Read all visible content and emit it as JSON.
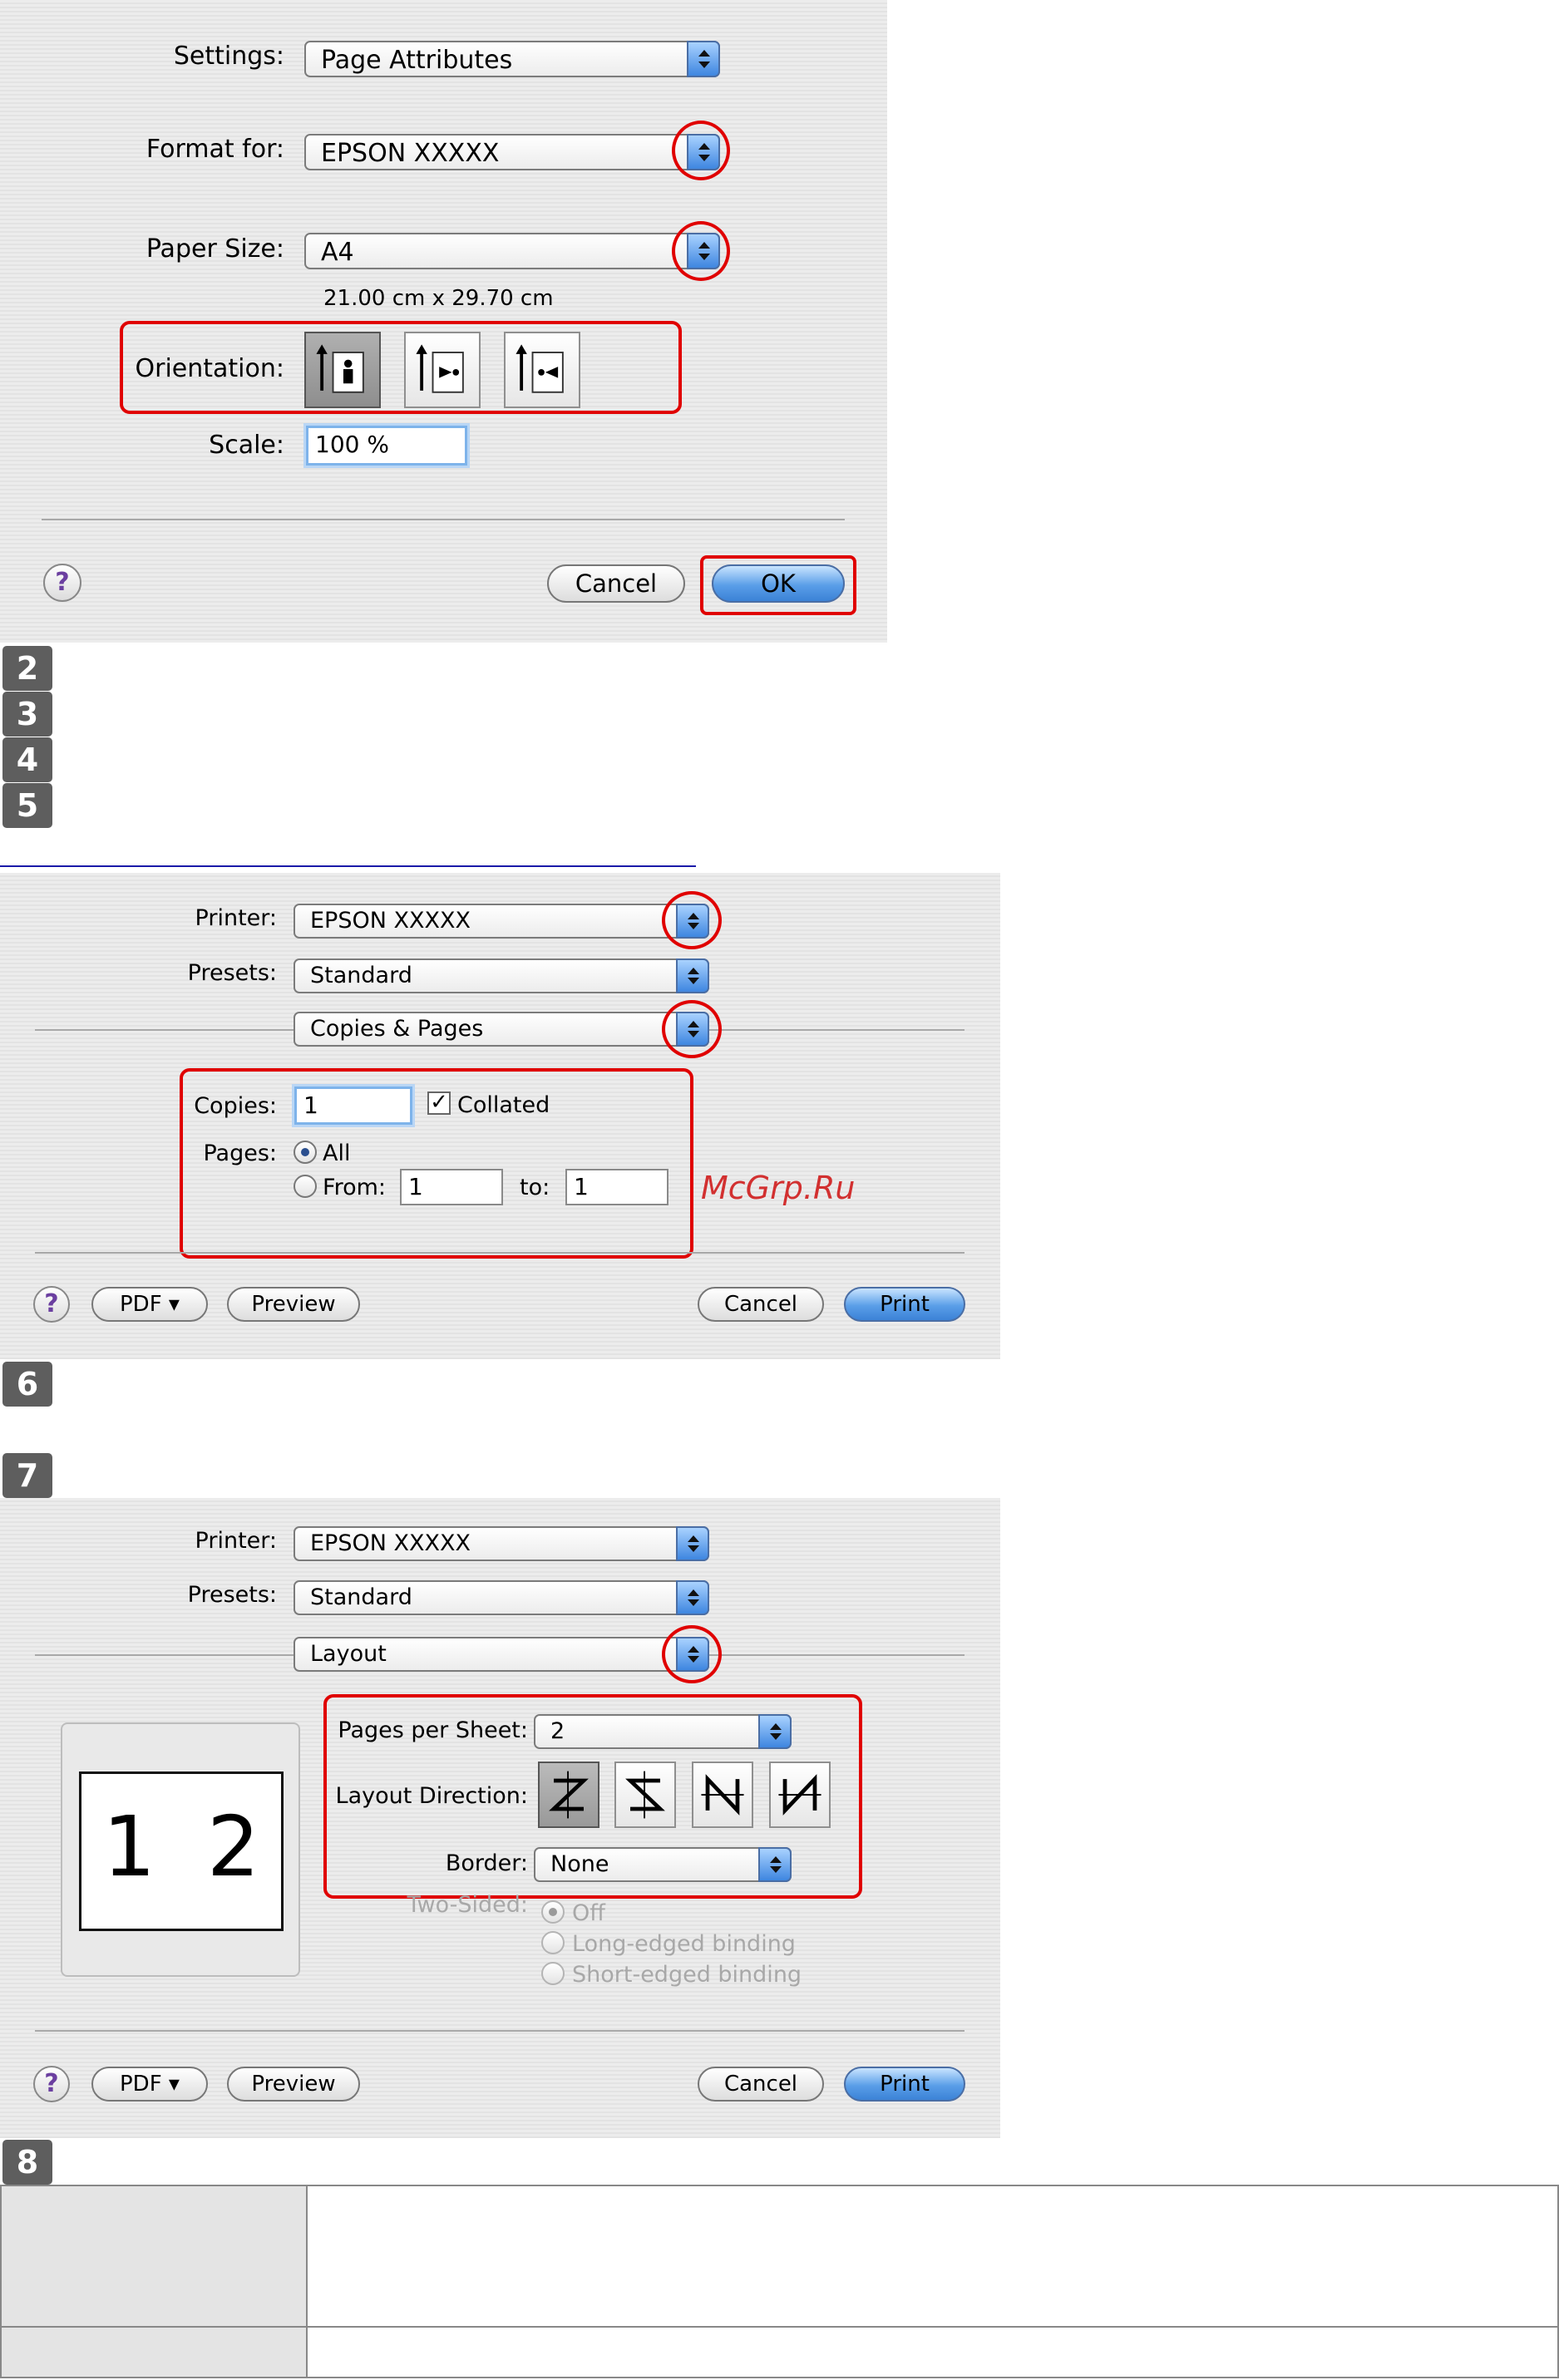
{
  "page_setup": {
    "settings_label": "Settings:",
    "settings_value": "Page Attributes",
    "format_for_label": "Format for:",
    "format_for_value": "EPSON XXXXX",
    "paper_size_label": "Paper Size:",
    "paper_size_value": "A4",
    "paper_dimensions": "21.00 cm x 29.70 cm",
    "orientation_label": "Orientation:",
    "orientation_selected": "portrait",
    "scale_label": "Scale:",
    "scale_value": "100 %",
    "help_glyph": "?",
    "cancel_label": "Cancel",
    "ok_label": "OK"
  },
  "steps": {
    "s2": "2",
    "s3": "3",
    "s4": "4",
    "s5": "5",
    "s6": "6",
    "s7": "7",
    "s8": "8"
  },
  "print_copies": {
    "printer_label": "Printer:",
    "printer_value": "EPSON XXXXX",
    "presets_label": "Presets:",
    "presets_value": "Standard",
    "panel_value": "Copies & Pages",
    "copies_label": "Copies:",
    "copies_value": "1",
    "collated_label": "Collated",
    "collated_checked": true,
    "pages_label": "Pages:",
    "all_label": "All",
    "from_label": "From:",
    "from_value": "1",
    "to_label": "to:",
    "to_value": "1",
    "help_glyph": "?",
    "pdf_label": "PDF ▾",
    "preview_label": "Preview",
    "cancel_label": "Cancel",
    "print_label": "Print"
  },
  "watermark": "McGrp.Ru",
  "print_layout": {
    "printer_label": "Printer:",
    "printer_value": "EPSON XXXXX",
    "presets_label": "Presets:",
    "presets_value": "Standard",
    "panel_value": "Layout",
    "preview_digits": "1 2",
    "pages_per_sheet_label": "Pages per Sheet:",
    "pages_per_sheet_value": "2",
    "layout_direction_label": "Layout Direction:",
    "border_label": "Border:",
    "border_value": "None",
    "two_sided_label": "Two-Sided:",
    "two_sided_off": "Off",
    "two_sided_long": "Long-edged binding",
    "two_sided_short": "Short-edged binding",
    "help_glyph": "?",
    "pdf_label": "PDF ▾",
    "preview_label": "Preview",
    "cancel_label": "Cancel",
    "print_label": "Print"
  },
  "colors": {
    "highlight_red": "#e00000",
    "default_button_blue": "#3b82d6"
  }
}
